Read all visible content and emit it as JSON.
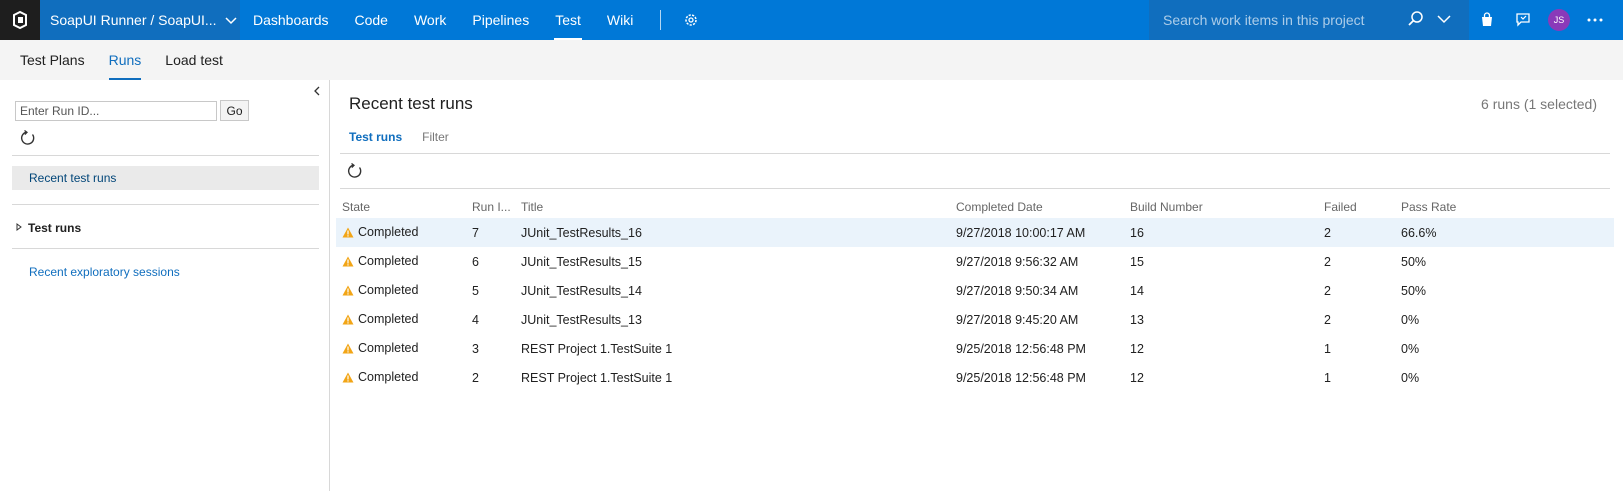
{
  "topbar": {
    "project": "SoapUI Runner / SoapUI...",
    "nav": [
      "Dashboards",
      "Code",
      "Work",
      "Pipelines",
      "Test",
      "Wiki"
    ],
    "active_nav": "Test",
    "search_placeholder": "Search work items in this project",
    "avatar_initials": "JS"
  },
  "subnav": {
    "tabs": [
      "Test Plans",
      "Runs",
      "Load test"
    ],
    "active": "Runs"
  },
  "left": {
    "run_id_placeholder": "Enter Run ID...",
    "go_label": "Go",
    "recent_label": "Recent test runs",
    "test_runs_label": "Test runs",
    "exploratory_label": "Recent exploratory sessions"
  },
  "main": {
    "title": "Recent test runs",
    "count": "6 runs (1 selected)",
    "tabs": [
      "Test runs",
      "Filter"
    ],
    "columns": [
      "State",
      "Run I...",
      "Title",
      "Completed Date",
      "Build Number",
      "Failed",
      "Pass Rate"
    ],
    "rows": [
      {
        "state": "Completed",
        "run_id": "7",
        "title": "JUnit_TestResults_16",
        "date": "9/27/2018 10:00:17 AM",
        "build": "16",
        "failed": "2",
        "pass_rate": "66.6%"
      },
      {
        "state": "Completed",
        "run_id": "6",
        "title": "JUnit_TestResults_15",
        "date": "9/27/2018 9:56:32 AM",
        "build": "15",
        "failed": "2",
        "pass_rate": "50%"
      },
      {
        "state": "Completed",
        "run_id": "5",
        "title": "JUnit_TestResults_14",
        "date": "9/27/2018 9:50:34 AM",
        "build": "14",
        "failed": "2",
        "pass_rate": "50%"
      },
      {
        "state": "Completed",
        "run_id": "4",
        "title": "JUnit_TestResults_13",
        "date": "9/27/2018 9:45:20 AM",
        "build": "13",
        "failed": "2",
        "pass_rate": "0%"
      },
      {
        "state": "Completed",
        "run_id": "3",
        "title": "REST Project 1.TestSuite 1",
        "date": "9/25/2018 12:56:48 PM",
        "build": "12",
        "failed": "1",
        "pass_rate": "0%"
      },
      {
        "state": "Completed",
        "run_id": "2",
        "title": "REST Project 1.TestSuite 1",
        "date": "9/25/2018 12:56:48 PM",
        "build": "12",
        "failed": "1",
        "pass_rate": "0%"
      }
    ]
  },
  "colors": {
    "topbar": "#0078d7",
    "accent": "#106ebe",
    "warning": "#f2a516"
  }
}
